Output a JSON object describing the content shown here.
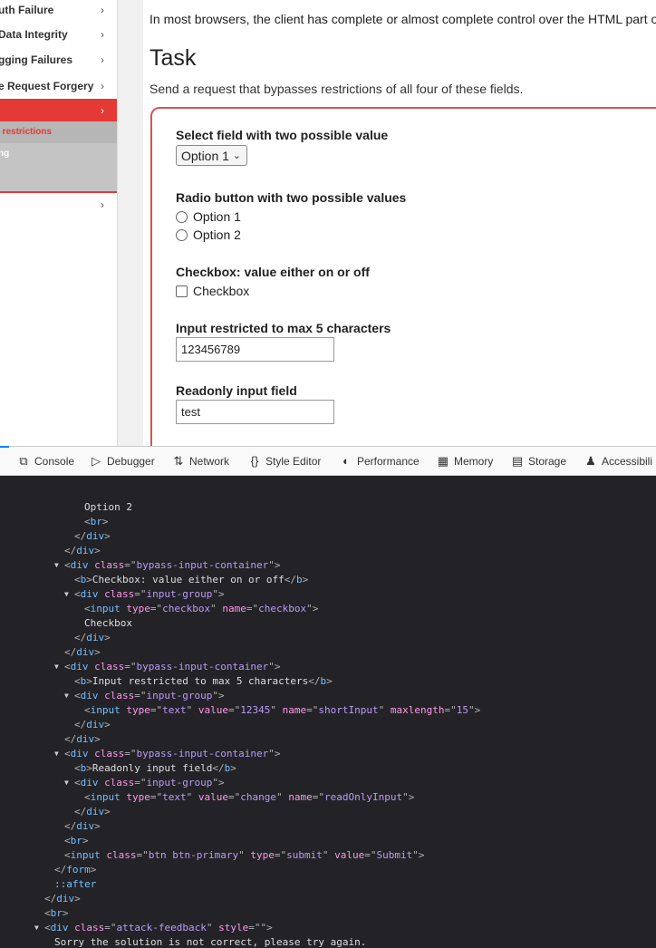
{
  "sidebar": {
    "items": [
      {
        "label": "uth Failure"
      },
      {
        "label": "Data Integrity"
      },
      {
        "label": "gging Failures"
      },
      {
        "label": "e Request Forgery"
      },
      {
        "label": ""
      },
      {
        "label": ""
      }
    ],
    "sub_items": [
      {
        "label": "l restrictions"
      },
      {
        "label": "ng"
      }
    ]
  },
  "main": {
    "intro": "In most browsers, the client has complete or almost complete control over the HTML part o",
    "task_title": "Task",
    "task_desc": "Send a request that bypasses restrictions of all four of these fields.",
    "select_label": "Select field with two possible value",
    "select_value": "Option 1",
    "radio_label": "Radio button with two possible values",
    "radio_options": [
      "Option 1",
      "Option 2"
    ],
    "checkbox_label": "Checkbox: value either on or off",
    "checkbox_text": "Checkbox",
    "short_label": "Input restricted to max 5 characters",
    "short_value": "123456789",
    "readonly_label": "Readonly input field",
    "readonly_value": "test"
  },
  "devtools": {
    "tabs": [
      "Console",
      "Debugger",
      "Network",
      "Style Editor",
      "Performance",
      "Memory",
      "Storage",
      "Accessibili"
    ],
    "tab_icons": [
      "console-icon",
      "debugger-icon",
      "network-icon",
      "style-editor-icon",
      "performance-icon",
      "memory-icon",
      "storage-icon",
      "accessibility-icon"
    ]
  },
  "code": {
    "option2_text": "Option 2",
    "br": "br",
    "div": "div",
    "b": "b",
    "input": "input",
    "form": "form",
    "class": "class",
    "type": "type",
    "name": "name",
    "value": "value",
    "maxlength": "maxlength",
    "style": "style",
    "bypass_container": "bypass-input-container",
    "input_group": "input-group",
    "checkbox_type": "checkbox",
    "checkbox_name": "checkbox",
    "checkbox_b": "Checkbox: value either on or off",
    "checkbox_text": "Checkbox",
    "short_b": "Input restricted to max 5 characters",
    "text_type": "text",
    "short_value": "12345",
    "short_name": "shortInput",
    "short_max": "15",
    "readonly_b": "Readonly input field",
    "readonly_value": "change",
    "readonly_name": "readOnlyInput",
    "btn_class": "btn btn-primary",
    "submit_type": "submit",
    "submit_value": "Submit",
    "after": "::after",
    "feedback_class": "attack-feedback",
    "feedback_style": "",
    "feedback_text": "Sorry the solution is not correct, please try again."
  }
}
